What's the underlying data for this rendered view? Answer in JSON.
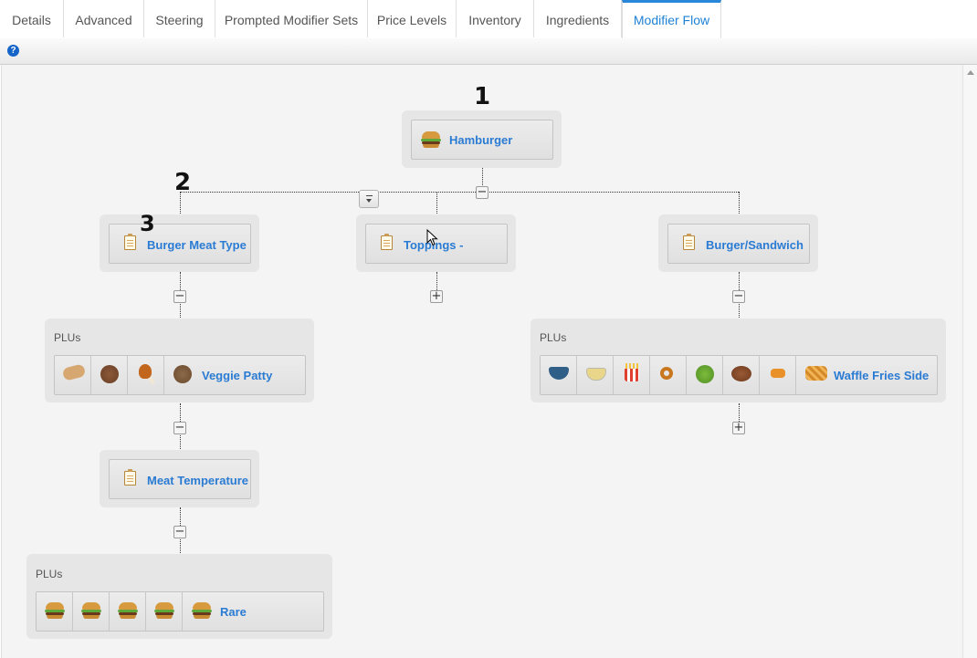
{
  "tabs": [
    {
      "label": "Details",
      "active": false
    },
    {
      "label": "Advanced",
      "active": false
    },
    {
      "label": "Steering",
      "active": false
    },
    {
      "label": "Prompted Modifier Sets",
      "active": false
    },
    {
      "label": "Price Levels",
      "active": false
    },
    {
      "label": "Inventory",
      "active": false
    },
    {
      "label": "Ingredients",
      "active": false
    },
    {
      "label": "Modifier Flow",
      "active": true
    }
  ],
  "toolbar": {
    "help_icon": "?"
  },
  "markers": {
    "one": "1",
    "two": "2",
    "three": "3"
  },
  "flow": {
    "root": {
      "label": "Hamburger",
      "icon": "hamburger-icon"
    },
    "modifier_sets": [
      {
        "label": "Burger Meat Type",
        "icon": "clipboard-icon",
        "collapse": "−"
      },
      {
        "label": "Toppings -",
        "icon": "clipboard-icon",
        "expand": "+"
      },
      {
        "label": "Burger/Sandwich",
        "icon": "clipboard-icon",
        "collapse": "−"
      }
    ],
    "plu_groups": [
      {
        "title": "PLUs",
        "items": [
          "chicken-breast-icon",
          "beef-patty-icon",
          "chicken-leg-icon"
        ],
        "last_label": "Veggie Patty",
        "last_icon": "veggie-patty-icon"
      },
      {
        "title": "PLUs",
        "items": [
          "soup-bowl-icon",
          "soup-cup-icon",
          "fries-icon",
          "onion-rings-icon",
          "salad-icon",
          "baked-potato-icon",
          "tots-icon"
        ],
        "last_label": "Waffle Fries Side",
        "last_icon": "waffle-fries-icon"
      },
      {
        "title": "PLUs",
        "items": [
          "burger-icon",
          "burger-icon",
          "burger-icon",
          "burger-icon"
        ],
        "last_label": "Rare",
        "last_icon": "burger-icon"
      }
    ],
    "sub_modifier": {
      "label": "Meat Temperature",
      "icon": "clipboard-icon"
    },
    "toggle_minus": "−",
    "toggle_plus": "+"
  },
  "colors": {
    "accent": "#1e82d6",
    "link": "#2a7bd3",
    "panel": "#e6e6e6",
    "canvas": "#f4f4f4"
  }
}
